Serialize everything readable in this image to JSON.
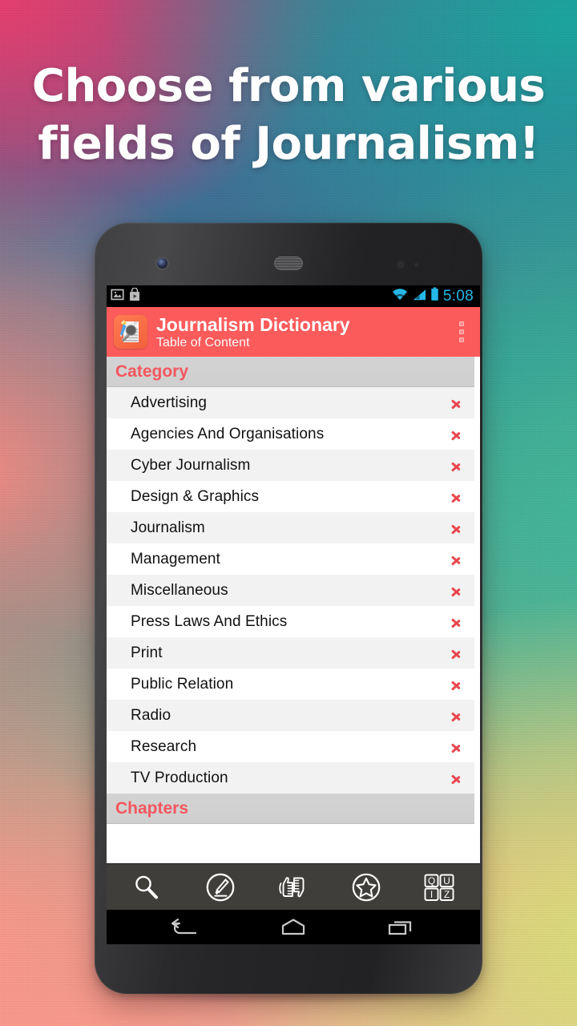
{
  "promo": {
    "headline_line1": "Choose from various",
    "headline_line2": "fields of Journalism!",
    "headline_color": "#ffffff"
  },
  "device": {
    "type": "android-phone",
    "body_color": "#242426"
  },
  "statusbar": {
    "time": "5:08",
    "time_color": "#25b7e8",
    "left_icons": [
      "screenshot-image-icon",
      "play-store-icon"
    ],
    "right_icons": [
      "wifi-icon",
      "cellular-signal-icon",
      "battery-icon"
    ]
  },
  "appbar": {
    "title": "Journalism Dictionary",
    "subtitle": "Table of Content",
    "background_color": "#fb5b5b",
    "app_icon": "journalism-dictionary-app-icon",
    "overflow_icon": "overflow-menu-icon"
  },
  "list": {
    "section_category_label": "Category",
    "section_chapters_label": "Chapters",
    "section_header_text_color": "#f4565f",
    "section_header_bg_color": "#d0d0d0",
    "chevron_color": "#e8474e",
    "items": [
      {
        "label": "Advertising"
      },
      {
        "label": "Agencies And Organisations"
      },
      {
        "label": "Cyber Journalism"
      },
      {
        "label": "Design & Graphics"
      },
      {
        "label": "Journalism"
      },
      {
        "label": "Management"
      },
      {
        "label": "Miscellaneous"
      },
      {
        "label": "Press Laws And Ethics"
      },
      {
        "label": "Print"
      },
      {
        "label": "Public Relation"
      },
      {
        "label": "Radio"
      },
      {
        "label": "Research"
      },
      {
        "label": "TV Production"
      }
    ]
  },
  "toolbar": {
    "background_color": "#403e3b",
    "buttons": [
      {
        "name": "search-icon",
        "label": "Search"
      },
      {
        "name": "pen-nib-icon",
        "label": "Write"
      },
      {
        "name": "thumbs-up-down-icon",
        "label": "Rate"
      },
      {
        "name": "star-icon",
        "label": "Favorites"
      },
      {
        "name": "quiz-icon",
        "label": "QUIZ"
      }
    ],
    "quiz_letters": [
      "Q",
      "U",
      "I",
      "Z"
    ]
  },
  "navbar": {
    "buttons": [
      {
        "name": "back-icon",
        "label": "Back"
      },
      {
        "name": "home-icon",
        "label": "Home"
      },
      {
        "name": "recents-icon",
        "label": "Recent apps"
      }
    ]
  }
}
